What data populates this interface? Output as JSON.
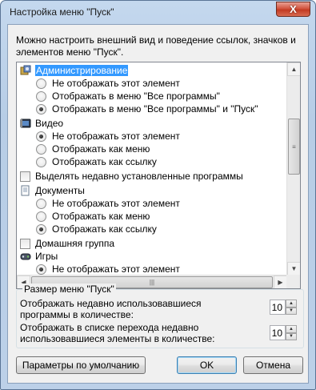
{
  "window": {
    "title": "Настройка меню \"Пуск\"",
    "close_glyph": "X"
  },
  "description": "Можно настроить внешний вид и поведение ссылок, значков и элементов меню \"Пуск\".",
  "list": {
    "admin": {
      "label": "Администрирование",
      "options": [
        "Не отображать этот элемент",
        "Отображать в меню \"Все программы\"",
        "Отображать в меню \"Все программы\" и \"Пуск\""
      ],
      "selected": 2
    },
    "video": {
      "label": "Видео",
      "options": [
        "Не отображать этот элемент",
        "Отображать как меню",
        "Отображать как ссылку"
      ],
      "selected": 0
    },
    "highlight_new": {
      "label": "Выделять недавно установленные программы",
      "checked": false
    },
    "documents": {
      "label": "Документы",
      "options": [
        "Не отображать этот элемент",
        "Отображать как меню",
        "Отображать как ссылку"
      ],
      "selected": 2
    },
    "homegroup": {
      "label": "Домашняя группа",
      "checked": false
    },
    "games": {
      "label": "Игры",
      "options": [
        "Не отображать этот элемент"
      ],
      "selected": 0
    }
  },
  "size_group": {
    "title": "Размер меню \"Пуск\"",
    "recent_programs_label_1": "Отображать недавно использовавшиеся",
    "recent_programs_label_2": "программы в количестве:",
    "recent_programs_value": "10",
    "jump_list_label_1": "Отображать в списке перехода недавно",
    "jump_list_label_2": "использовавшиеся элементы в количестве:",
    "jump_list_value": "10"
  },
  "buttons": {
    "defaults": "Параметры по умолчанию",
    "ok": "OK",
    "cancel": "Отмена"
  },
  "colors": {
    "selection": "#3399ff",
    "window_frame": "#b9cfe8",
    "close": "#c23a22"
  }
}
